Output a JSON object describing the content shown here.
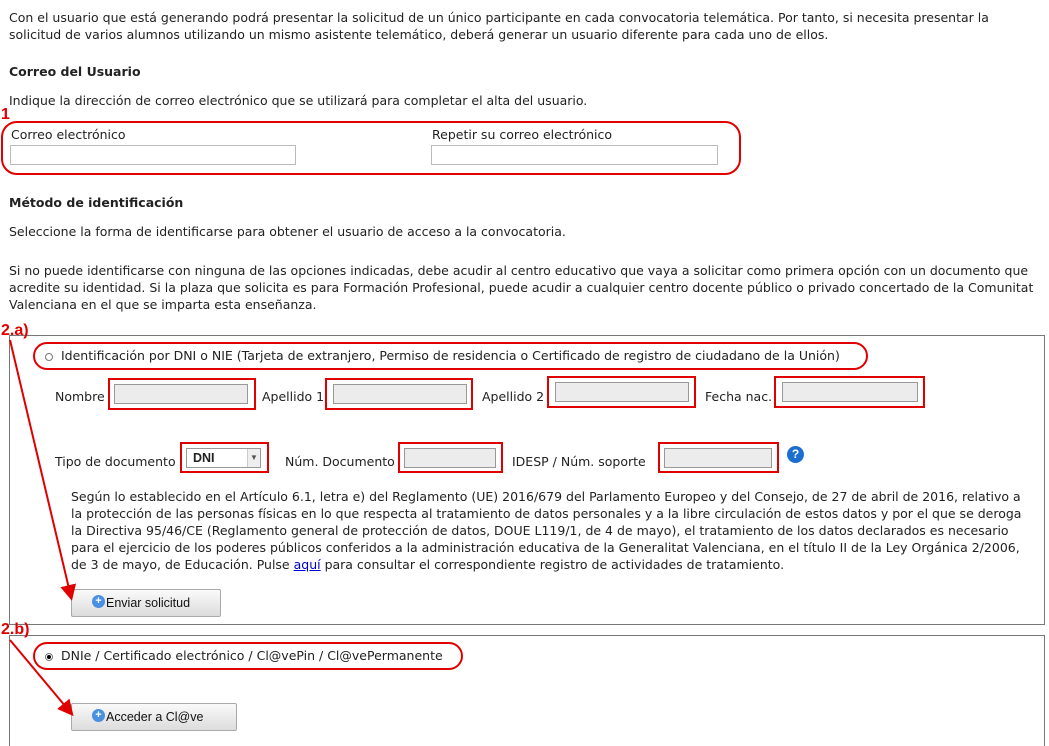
{
  "intro": "Con el usuario que está generando podrá presentar la solicitud de un único participante en cada convocatoria telemática. Por tanto, si necesita presentar la solicitud de varios alumnos utilizando un mismo asistente telemático, deberá generar un usuario diferente para cada uno de ellos.",
  "email_section": {
    "heading": "Correo del Usuario",
    "description": "Indique la dirección de correo electrónico que se utilizará para completar el alta del usuario.",
    "email_label": "Correo electrónico",
    "email_value": "",
    "repeat_label": "Repetir su correo electrónico",
    "repeat_value": ""
  },
  "identification": {
    "heading": "Método de identificación",
    "description": "Seleccione la forma de identificarse para obtener el usuario de acceso a la convocatoria.",
    "note": "Si no puede identificarse con ninguna de las opciones indicadas, debe acudir al centro educativo que vaya a solicitar como primera opción con un documento que acredite su identidad. Si la plaza que solicita es para Formación Profesional, puede acudir a cualquier centro docente público o privado concertado de la Comunitat Valenciana en el que se imparta esta enseñanza."
  },
  "option_a": {
    "radio_label": "Identificación por DNI o NIE (Tarjeta de extranjero, Permiso de residencia o Certificado de registro de ciudadano de la Unión)",
    "checked": false,
    "nombre_label": "Nombre",
    "apellido1_label": "Apellido 1",
    "apellido2_label": "Apellido 2",
    "fecha_label": "Fecha nac.",
    "tipo_label": "Tipo de documento",
    "tipo_value": "DNI",
    "num_doc_label": "Núm. Documento",
    "idesp_label": "IDESP / Núm. soporte",
    "legal_text": "Según lo establecido en el Artículo 6.1, letra e) del Reglamento (UE) 2016/679 del Parlamento Europeo y del Consejo, de 27 de abril de 2016, relativo a la protección de las personas físicas en lo que respecta al tratamiento de datos personales y a la libre circulación de estos datos y por el que se deroga la Directiva 95/46/CE (Reglamento general de protección de datos, DOUE L119/1, de 4 de mayo), el tratamiento de los datos declarados es necesario para el ejercicio de los poderes públicos conferidos a la administración educativa de la Generalitat Valenciana, en el título II de la Ley Orgánica 2/2006, de 3 de mayo, de Educación. Pulse ",
    "legal_link": "aquí",
    "legal_tail": " para consultar el correspondiente registro de actividades de tratamiento.",
    "submit_label": "Enviar solicitud"
  },
  "option_b": {
    "radio_label": "DNIe / Certificado electrónico / Cl@vePin / Cl@vePermanente",
    "checked": true,
    "button_label": "Acceder a Cl@ve"
  },
  "annotations": {
    "tag1": "1",
    "tag2a": "2.a)",
    "tag2b": "2.b)"
  },
  "icons": {
    "help": "help-icon",
    "plus": "plus-circle-icon"
  },
  "colors": {
    "annotation": "#e00000",
    "link": "#0000cc",
    "help": "#1c6fd0"
  }
}
